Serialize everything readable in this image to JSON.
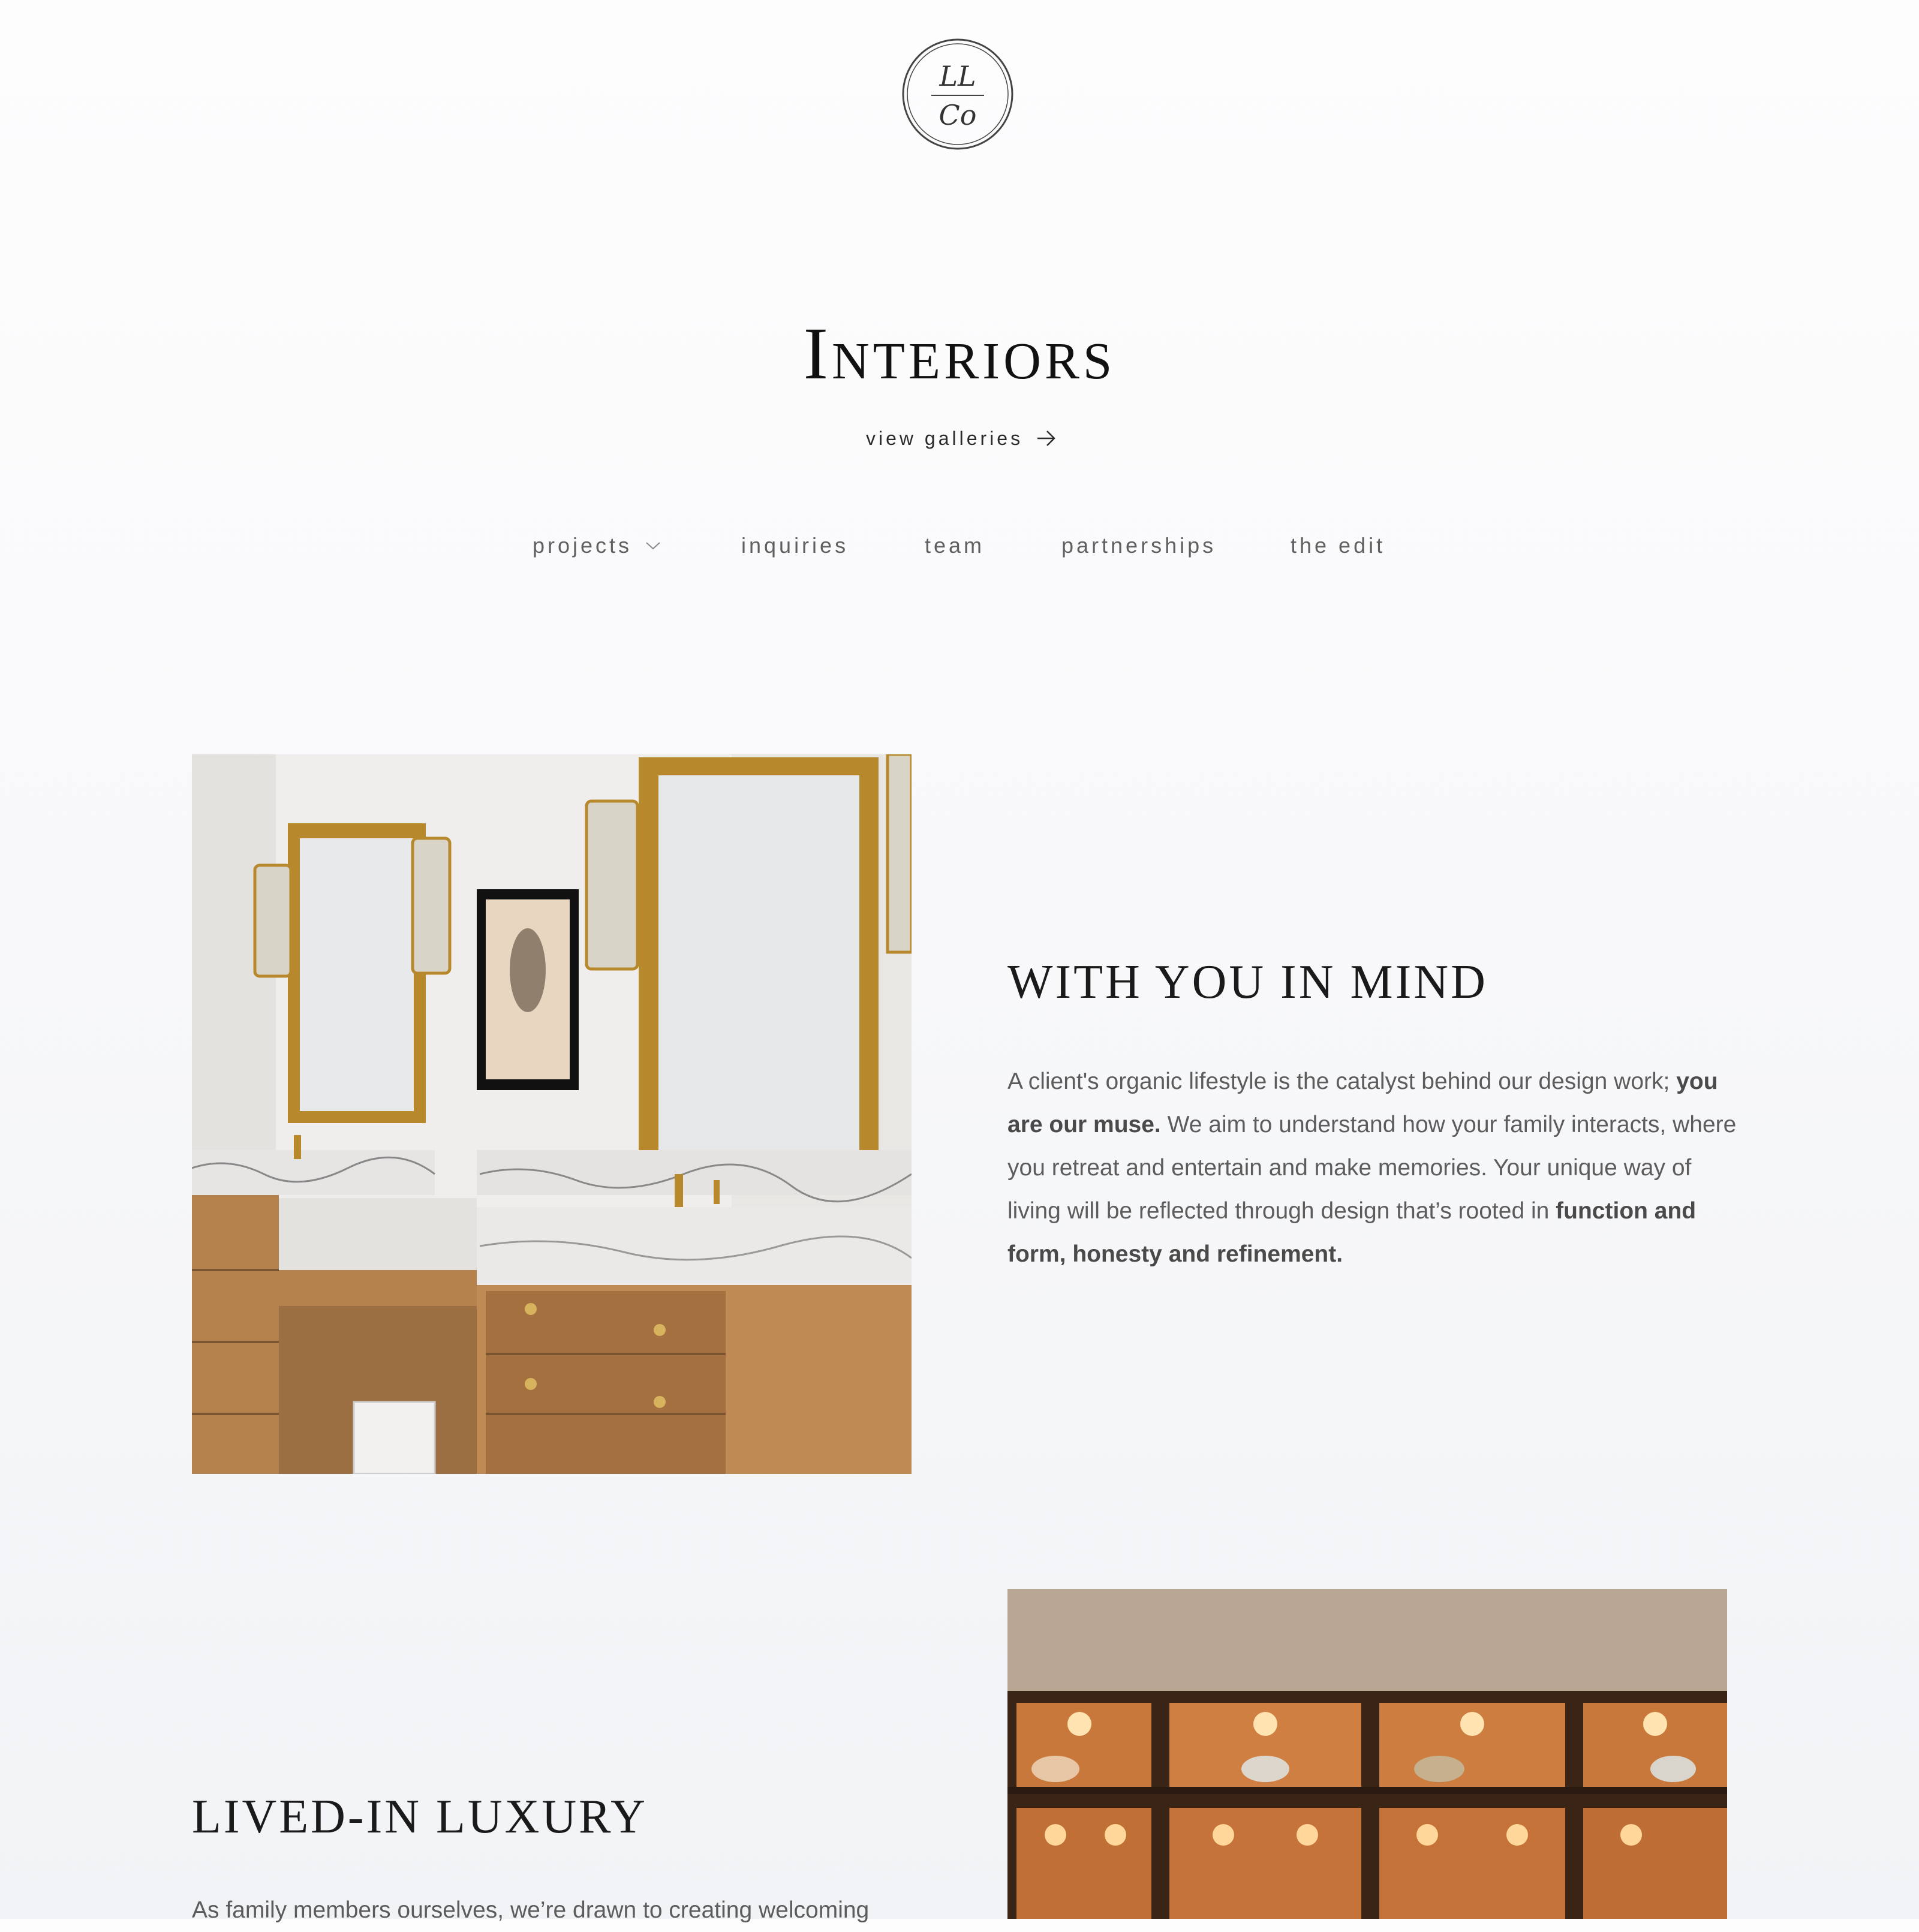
{
  "logo": {
    "line1": "LL",
    "line2": "Co"
  },
  "hero": {
    "title": "Interiors",
    "cta": "view galleries"
  },
  "nav": {
    "items": [
      {
        "label": "projects",
        "has_dropdown": true
      },
      {
        "label": "inquiries"
      },
      {
        "label": "team"
      },
      {
        "label": "partnerships"
      },
      {
        "label": "the edit"
      }
    ]
  },
  "section1": {
    "heading": "With you in mind",
    "text_1": "A client's organic lifestyle is the catalyst behind our design work; ",
    "bold_1": "you are our muse.",
    "text_2": " We aim to understand how your family interacts, where you retreat and entertain and make memories. Your unique way of living will be reflected through design that’s rooted in ",
    "bold_2": "function and form, honesty and refinement."
  },
  "section2": {
    "heading": "Lived-in luxury",
    "text_1": "As family members ourselves, we’re drawn to creating welcoming"
  },
  "icons": {
    "arrow": "arrow-right-icon",
    "chevron": "chevron-down-icon"
  },
  "colors": {
    "background": "#f9f9fb",
    "text": "#5c5c5c",
    "heading": "#111111",
    "brass": "#b8892c"
  }
}
